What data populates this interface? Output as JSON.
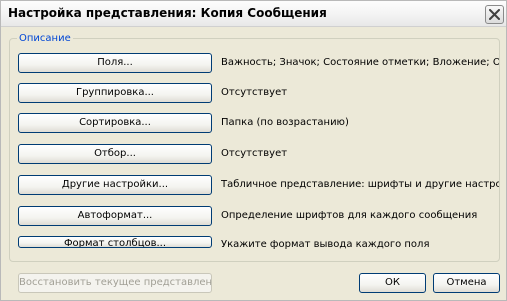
{
  "window": {
    "title": "Настройка представления: Копия Сообщения",
    "close_icon": "close-icon"
  },
  "group": {
    "legend": "Описание"
  },
  "rows": [
    {
      "button": "Поля...",
      "description": "Важность; Значок; Состояние отметки; Вложение; От, ..."
    },
    {
      "button": "Группировка...",
      "description": "Отсутствует"
    },
    {
      "button": "Сортировка...",
      "description": "Папка (по возрастанию)"
    },
    {
      "button": "Отбор...",
      "description": "Отсутствует"
    },
    {
      "button": "Другие настройки...",
      "description": "Табличное представление: шрифты и другие настройки"
    },
    {
      "button": "Автоформат...",
      "description": "Определение шрифтов для каждого сообщения"
    },
    {
      "button": "Формат столбцов...",
      "description": "Укажите формат вывода каждого поля"
    }
  ],
  "footer": {
    "reset_label": "Восстановить текущее представление",
    "ok_label": "ОК",
    "cancel_label": "Отмена"
  }
}
